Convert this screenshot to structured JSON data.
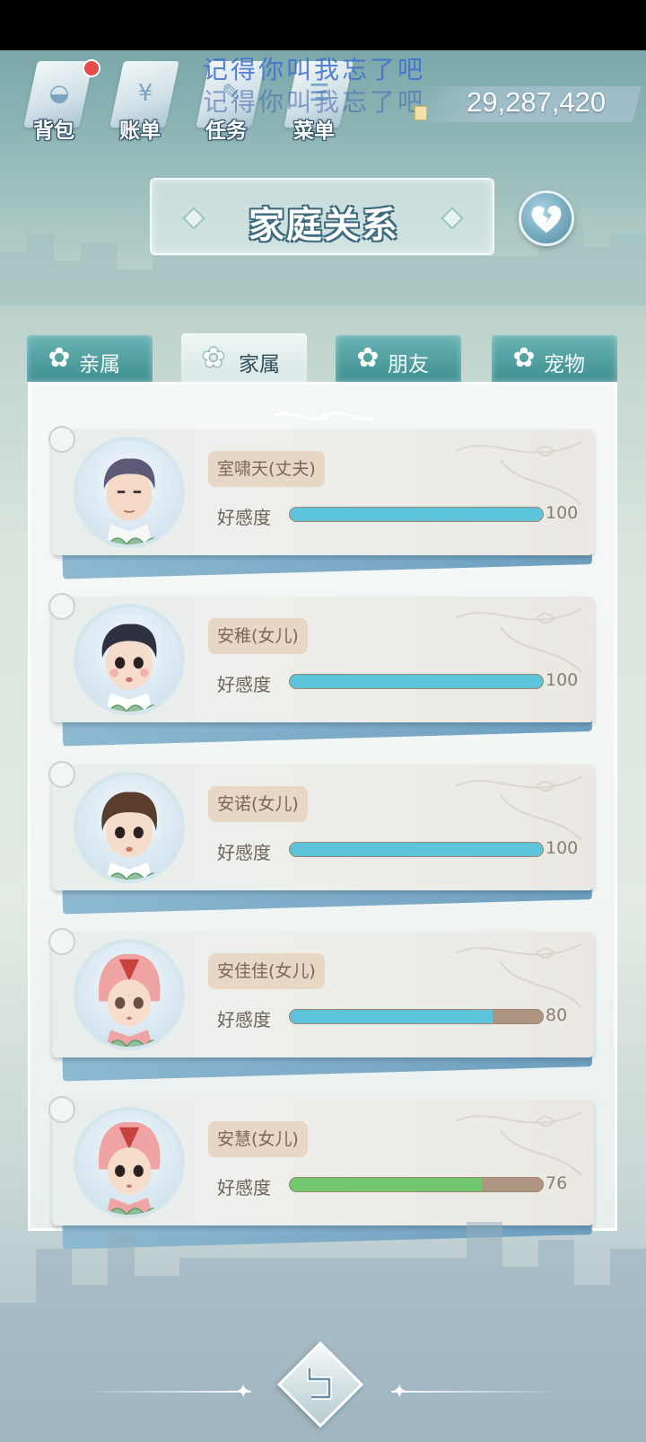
{
  "topbar": {
    "buttons": [
      {
        "label": "背包",
        "icon": "backpack-icon",
        "has_badge": true
      },
      {
        "label": "账单",
        "icon": "bill-icon",
        "has_badge": false
      },
      {
        "label": "任务",
        "icon": "task-icon",
        "has_badge": false
      },
      {
        "label": "菜单",
        "icon": "menu-icon",
        "has_badge": false
      }
    ],
    "overlay_line_1": "记得你叫我忘了吧",
    "overlay_line_2": "记得你叫我忘了吧",
    "currency_value": "29,287,420"
  },
  "title": "家庭关系",
  "tabs": [
    {
      "label": "亲属",
      "active": false
    },
    {
      "label": "家属",
      "active": true
    },
    {
      "label": "朋友",
      "active": false
    },
    {
      "label": "宠物",
      "active": false
    }
  ],
  "members": [
    {
      "name": "室啸天(丈夫)",
      "favor_label": "好感度",
      "favor_value": "100",
      "favor": 100,
      "bar_color": "#5ec4dc"
    },
    {
      "name": "安稚(女儿)",
      "favor_label": "好感度",
      "favor_value": "100",
      "favor": 100,
      "bar_color": "#5ec4dc"
    },
    {
      "name": "安诺(女儿)",
      "favor_label": "好感度",
      "favor_value": "100",
      "favor": 100,
      "bar_color": "#5ec4dc"
    },
    {
      "name": "安佳佳(女儿)",
      "favor_label": "好感度",
      "favor_value": "80",
      "favor": 80,
      "bar_color": "#5ec4dc"
    },
    {
      "name": "安慧(女儿)",
      "favor_label": "好感度",
      "favor_value": "76",
      "favor": 76,
      "bar_color": "#72c870"
    }
  ],
  "colors": {
    "accent_teal": "#3f8f92",
    "bar_blue": "#5ec4dc",
    "bar_green": "#72c870",
    "bar_track": "#ad9581",
    "badge_red": "#e84a4a"
  }
}
